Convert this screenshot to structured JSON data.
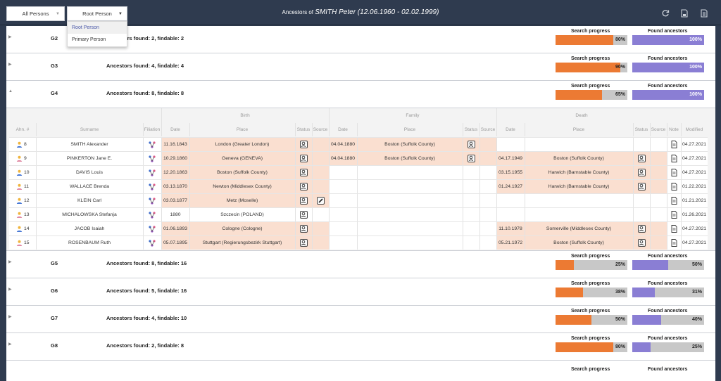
{
  "toolbar": {
    "filter_all": "All Persons",
    "filter_root": "Root Person",
    "title_prefix": "Ancestors of",
    "title_name": "SMITH Peter (12.06.1960 - 02.02.1999)",
    "icons": [
      "refresh-icon",
      "save-icon",
      "export-icon"
    ]
  },
  "dropdown": {
    "items": [
      "Root Person",
      "Primary Person"
    ],
    "selected": "Root Person"
  },
  "labels": {
    "search_progress": "Search progress",
    "found_ancestors": "Found ancestors"
  },
  "generations": [
    {
      "name": "G2",
      "found": "Ancestors found: 2, findable: 2",
      "search": 0.8,
      "search_pct": "80%",
      "found_frac": 1.0,
      "found_pct": "100%",
      "expanded": false
    },
    {
      "name": "G3",
      "found": "Ancestors found: 4, findable: 4",
      "search": 0.9,
      "search_pct": "90%",
      "found_frac": 1.0,
      "found_pct": "100%",
      "expanded": false
    },
    {
      "name": "G4",
      "found": "Ancestors found: 8, findable: 8",
      "search": 0.65,
      "search_pct": "65%",
      "found_frac": 1.0,
      "found_pct": "100%",
      "expanded": true
    },
    {
      "name": "G5",
      "found": "Ancestors found: 8, findable: 16",
      "search": 0.25,
      "search_pct": "25%",
      "found_frac": 0.5,
      "found_pct": "50%",
      "expanded": false
    },
    {
      "name": "G6",
      "found": "Ancestors found: 5, findable: 16",
      "search": 0.38,
      "search_pct": "38%",
      "found_frac": 0.31,
      "found_pct": "31%",
      "expanded": false
    },
    {
      "name": "G7",
      "found": "Ancestors found: 4, findable: 10",
      "search": 0.5,
      "search_pct": "50%",
      "found_frac": 0.4,
      "found_pct": "40%",
      "expanded": false
    },
    {
      "name": "G8",
      "found": "Ancestors found: 2, findable: 8",
      "search": 0.8,
      "search_pct": "80%",
      "found_frac": 0.25,
      "found_pct": "25%",
      "expanded": false
    }
  ],
  "table": {
    "group_headers": {
      "birth": "Birth",
      "family": "Family",
      "death": "Death"
    },
    "headers": {
      "ahn": "Ahn. #",
      "surname": "Surname",
      "filiation": "Filiation",
      "date": "Date",
      "place": "Place",
      "status": "Status",
      "source": "Source",
      "note": "Note",
      "modified": "Modified"
    },
    "rows": [
      {
        "ahn": "8",
        "gender": "male",
        "surname": "SMITH Alexander",
        "birth_date": "11.16.1843",
        "birth_place": "London (Greater London)",
        "birth_status": true,
        "birth_source": false,
        "family_date": "04.04.1880",
        "family_place": "Boston (Suffolk County)",
        "family_status": true,
        "death_date": "",
        "death_place": "",
        "death_status": false,
        "modified": "04.27.2021"
      },
      {
        "ahn": "9",
        "gender": "female",
        "surname": "PINKERTON Jane E.",
        "birth_date": "10.29.1860",
        "birth_place": "Geneva (GENEVA)",
        "birth_status": true,
        "birth_source": false,
        "family_date": "04.04.1880",
        "family_place": "Boston (Suffolk County)",
        "family_status": true,
        "death_date": "04.17.1949",
        "death_place": "Boston (Suffolk County)",
        "death_status": true,
        "modified": "04.27.2021"
      },
      {
        "ahn": "10",
        "gender": "male",
        "surname": "DAVIS Louis",
        "birth_date": "12.20.1863",
        "birth_place": "Boston (Suffolk County)",
        "birth_status": true,
        "birth_source": false,
        "family_date": "",
        "family_place": "",
        "family_status": false,
        "death_date": "03.15.1955",
        "death_place": "Harwich (Barnstable County)",
        "death_status": true,
        "modified": "04.27.2021"
      },
      {
        "ahn": "11",
        "gender": "female",
        "surname": "WALLACE Brenda",
        "birth_date": "03.13.1870",
        "birth_place": "Newton (Middlesex County)",
        "birth_status": true,
        "birth_source": false,
        "family_date": "",
        "family_place": "",
        "family_status": false,
        "death_date": "01.24.1927",
        "death_place": "Harwich (Barnstable County)",
        "death_status": true,
        "modified": "01.22.2021"
      },
      {
        "ahn": "12",
        "gender": "male",
        "surname": "KLEIN Carl",
        "birth_date": "03.03.1877",
        "birth_place": "Metz (Moselle)",
        "birth_status": true,
        "birth_source": true,
        "family_date": "",
        "family_place": "",
        "family_status": false,
        "death_date": "",
        "death_place": "",
        "death_status": false,
        "modified": "01.21.2021"
      },
      {
        "ahn": "13",
        "gender": "female",
        "surname": "MICHALOWSKA Stefanja",
        "birth_date": "1880",
        "birth_place": "Szczecin (POLAND)",
        "birth_status": true,
        "birth_source": false,
        "family_date": "",
        "family_place": "",
        "family_status": false,
        "death_date": "",
        "death_place": "",
        "death_status": false,
        "modified": "01.26.2021"
      },
      {
        "ahn": "14",
        "gender": "male",
        "surname": "JACOB Isaiah",
        "birth_date": "01.06.1893",
        "birth_place": "Cologne (Cologne)",
        "birth_status": true,
        "birth_source": false,
        "family_date": "",
        "family_place": "",
        "family_status": false,
        "death_date": "11.10.1978",
        "death_place": "Somerville (Middlesex County)",
        "death_status": true,
        "modified": "04.27.2021"
      },
      {
        "ahn": "15",
        "gender": "female",
        "surname": "ROSENBAUM Ruth",
        "birth_date": "05.07.1895",
        "birth_place": "Stuttgart (Regierungsbezirk Stuttgart)",
        "birth_status": true,
        "birth_source": false,
        "family_date": "",
        "family_place": "",
        "family_status": false,
        "death_date": "05.21.1972",
        "death_place": "Boston (Suffolk County)",
        "death_status": true,
        "modified": "04.27.2021"
      }
    ]
  },
  "colors": {
    "topbar": "#2f3b4f",
    "search_fill": "#ec7a33",
    "found_fill": "#8a7ed4",
    "highlight": "#fadfd0"
  }
}
